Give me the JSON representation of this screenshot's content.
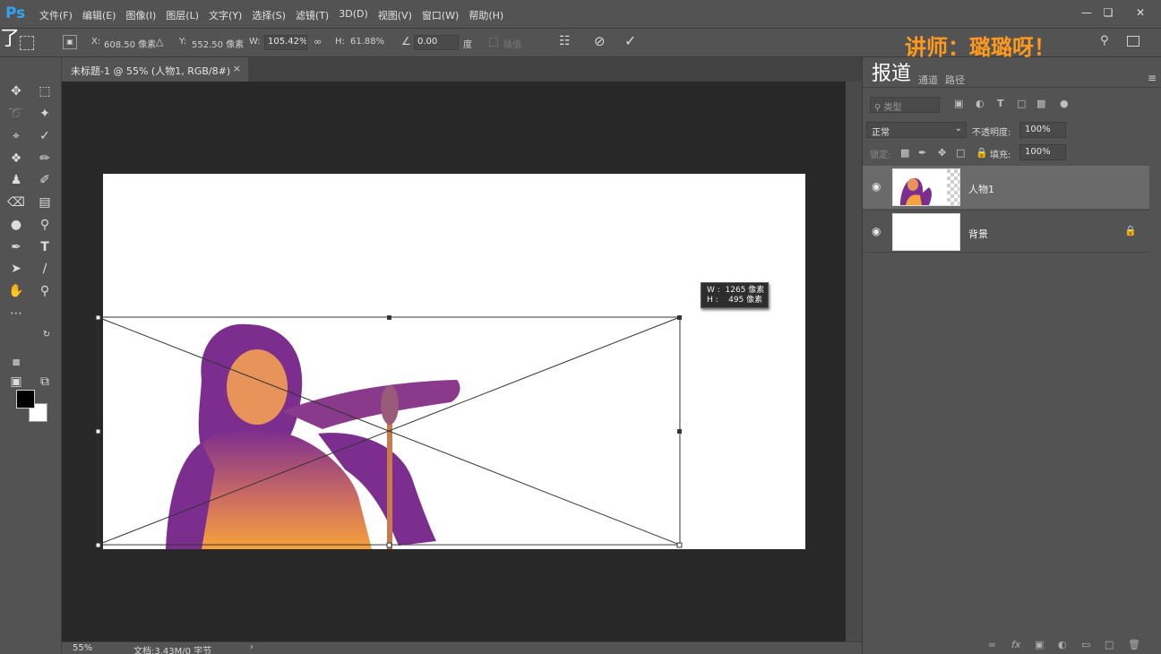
{
  "app": {
    "logo": "Ps"
  },
  "menu": [
    "文件(F)",
    "编辑(E)",
    "图像(I)",
    "图层(L)",
    "文字(Y)",
    "选择(S)",
    "滤镜(T)",
    "3D(D)",
    "视图(V)",
    "窗口(W)",
    "帮助(H)"
  ],
  "window_controls": [
    "minimize-icon",
    "restore-icon",
    "close-icon"
  ],
  "options": {
    "x_label": "X:",
    "x_value": "608.50 像素",
    "y_label": "Y:",
    "y_value": "552.50 像素",
    "w_label": "W:",
    "w_value": "105.42%",
    "h_label": "H:",
    "h_value": "61.88%",
    "angle_value": "0.00",
    "angle_unit": "度",
    "interpolation_label": "插值",
    "cancel_icon": "cancel-icon",
    "commit_icon": "commit-icon"
  },
  "overlays": {
    "left_char": "了",
    "lecturer": "讲师：璐璐呀！",
    "news": "报道"
  },
  "document": {
    "tab_title": "未标题-1 @ 55% (人物1, RGB/8#)",
    "tab_close": "×"
  },
  "transform": {
    "tooltip_w": "W :  1265 像素",
    "tooltip_h": "H :    495 像素"
  },
  "status": {
    "zoom": "55%",
    "doc_size": "文档:3.43M/0 字节",
    "arrow": "›"
  },
  "layers_panel": {
    "tabs": [
      "通道",
      "路径"
    ],
    "filter_placeholder": "类型",
    "blend_mode": "正常",
    "opacity_label": "不透明度:",
    "opacity_value": "100%",
    "lock_label": "锁定:",
    "fill_label": "填充:",
    "fill_value": "100%",
    "layers": [
      {
        "name": "人物1",
        "selected": true,
        "visible": true
      },
      {
        "name": "背景",
        "selected": false,
        "visible": true,
        "locked": true
      }
    ]
  },
  "colors": {
    "accent": "#2fa3f6",
    "lecturer_text": "#ff9a1f",
    "foreground": "#000000",
    "background": "#ffffff",
    "figure_orange": "#f7a23b",
    "figure_purple": "#7c2e8f"
  }
}
